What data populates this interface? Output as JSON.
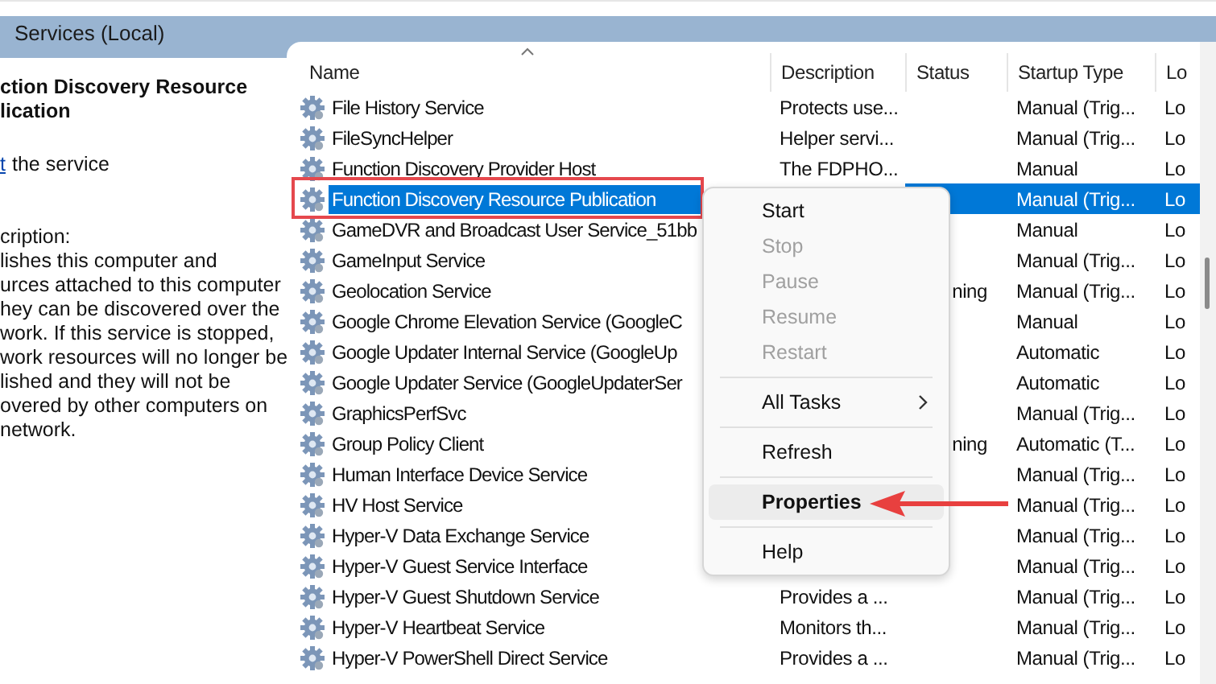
{
  "window": {
    "title": "Services (Local)"
  },
  "details": {
    "title_lines": [
      "ction Discovery Resource",
      "lication"
    ],
    "action_link": "t",
    "action_text": "the service",
    "description_label": "cription:",
    "description_lines": [
      "lishes this computer and",
      "urces attached to this computer",
      "hey can be discovered over the",
      "work.  If this service is stopped,",
      "work resources will no longer be",
      "lished and they will not be",
      "overed by other computers on",
      "network."
    ]
  },
  "table": {
    "columns": [
      {
        "label": "Name",
        "sorted": true
      },
      {
        "label": "Description",
        "sorted": false
      },
      {
        "label": "Status",
        "sorted": false
      },
      {
        "label": "Startup Type",
        "sorted": false
      },
      {
        "label": "Lo",
        "sorted": false
      }
    ],
    "rows": [
      {
        "name": "File History Service",
        "description": "Protects use...",
        "startup_type": "Manual (Trig...",
        "log_on": "Lo",
        "selected": false
      },
      {
        "name": "FileSyncHelper",
        "description": "Helper servi...",
        "startup_type": "Manual (Trig...",
        "log_on": "Lo",
        "selected": false
      },
      {
        "name": "Function Discovery Provider Host",
        "description": "The FDPHO...",
        "startup_type": "Manual",
        "log_on": "Lo",
        "selected": false
      },
      {
        "name": "Function Discovery Resource Publication",
        "startup_type": "Manual (Trig...",
        "log_on": "Lo",
        "selected": true
      },
      {
        "name": "GameDVR and Broadcast User Service_51bb",
        "startup_type": "Manual",
        "log_on": "Lo",
        "selected": false
      },
      {
        "name": "GameInput Service",
        "startup_type": "Manual (Trig...",
        "log_on": "Lo",
        "selected": false
      },
      {
        "name": "Geolocation Service",
        "status": "ning",
        "startup_type": "Manual (Trig...",
        "log_on": "Lo",
        "selected": false
      },
      {
        "name": "Google Chrome Elevation Service (GoogleC",
        "startup_type": "Manual",
        "log_on": "Lo",
        "selected": false
      },
      {
        "name": "Google Updater Internal Service (GoogleUp",
        "startup_type": "Automatic",
        "log_on": "Lo",
        "selected": false
      },
      {
        "name": "Google Updater Service (GoogleUpdaterSer",
        "startup_type": "Automatic",
        "log_on": "Lo",
        "selected": false
      },
      {
        "name": "GraphicsPerfSvc",
        "startup_type": "Manual (Trig...",
        "log_on": "Lo",
        "selected": false
      },
      {
        "name": "Group Policy Client",
        "status": "ning",
        "startup_type": "Automatic (T...",
        "log_on": "Lo",
        "selected": false
      },
      {
        "name": "Human Interface Device Service",
        "startup_type": "Manual (Trig...",
        "log_on": "Lo",
        "selected": false
      },
      {
        "name": "HV Host Service",
        "startup_type": "Manual (Trig...",
        "log_on": "Lo",
        "selected": false
      },
      {
        "name": "Hyper-V Data Exchange Service",
        "startup_type": "Manual (Trig...",
        "log_on": "Lo",
        "selected": false
      },
      {
        "name": "Hyper-V Guest Service Interface",
        "startup_type": "Manual (Trig...",
        "log_on": "Lo",
        "selected": false
      },
      {
        "name": "Hyper-V Guest Shutdown Service",
        "description": "Provides a ...",
        "startup_type": "Manual (Trig...",
        "log_on": "Lo",
        "selected": false
      },
      {
        "name": "Hyper-V Heartbeat Service",
        "description": "Monitors th...",
        "startup_type": "Manual (Trig...",
        "log_on": "Lo",
        "selected": false
      },
      {
        "name": "Hyper-V PowerShell Direct Service",
        "description": "Provides a ...",
        "startup_type": "Manual (Trig...",
        "log_on": "Lo",
        "selected": false
      }
    ]
  },
  "context_menu": {
    "items": [
      {
        "kind": "item",
        "label": "Start",
        "disabled": false,
        "selected": false,
        "default": false
      },
      {
        "kind": "item",
        "label": "Stop",
        "disabled": true,
        "selected": false,
        "default": false
      },
      {
        "kind": "item",
        "label": "Pause",
        "disabled": true,
        "selected": false,
        "default": false
      },
      {
        "kind": "item",
        "label": "Resume",
        "disabled": true,
        "selected": false,
        "default": false
      },
      {
        "kind": "item",
        "label": "Restart",
        "disabled": true,
        "selected": false,
        "default": false
      },
      {
        "kind": "separator"
      },
      {
        "kind": "submenu",
        "label": "All Tasks",
        "disabled": false,
        "selected": false,
        "default": false
      },
      {
        "kind": "separator"
      },
      {
        "kind": "item",
        "label": "Refresh",
        "disabled": false,
        "selected": false,
        "default": false
      },
      {
        "kind": "separator"
      },
      {
        "kind": "item",
        "label": "Properties",
        "disabled": false,
        "selected": true,
        "default": true
      },
      {
        "kind": "separator"
      },
      {
        "kind": "item",
        "label": "Help",
        "disabled": false,
        "selected": false,
        "default": false
      }
    ]
  }
}
